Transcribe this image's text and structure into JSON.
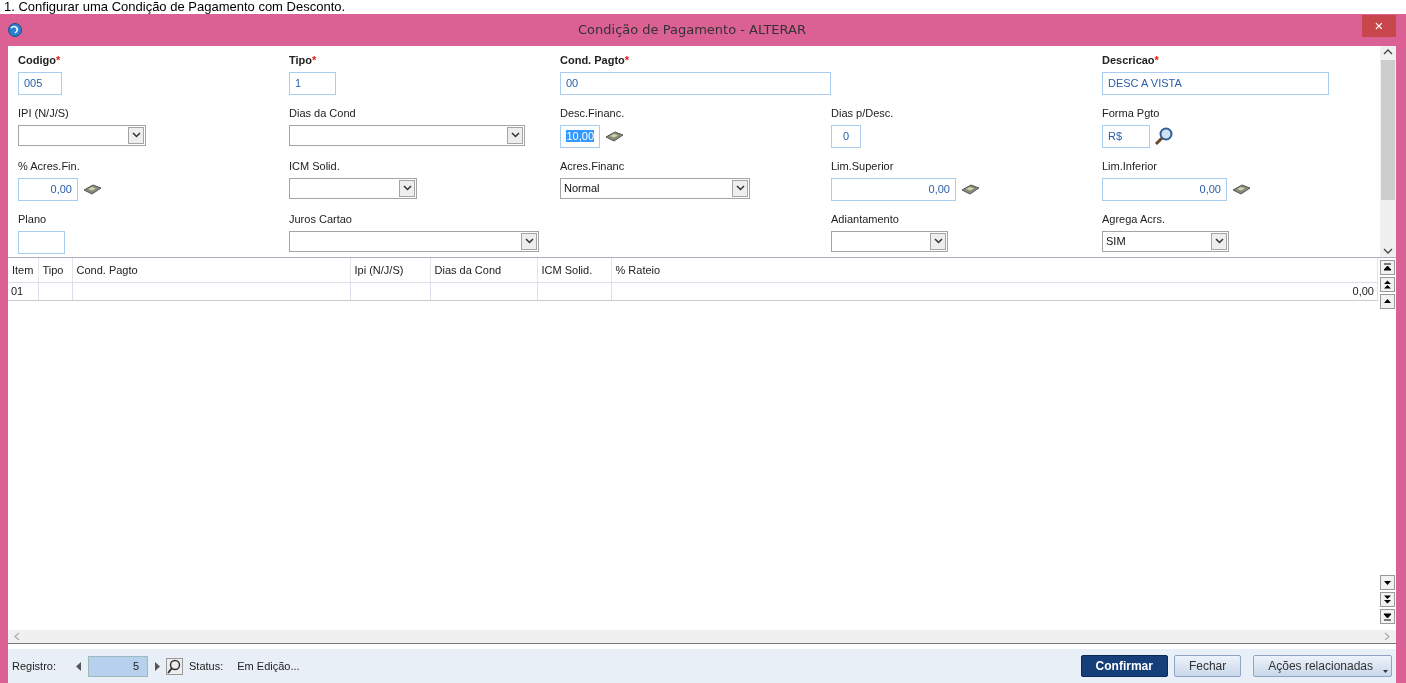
{
  "doc_heading": "1.    Configurar uma Condição de Pagamento com Desconto.",
  "window": {
    "title": "Condição de Pagamento - ALTERAR",
    "close": "×"
  },
  "form_rows": [
    [
      {
        "label": "Codigo",
        "mark": "*",
        "kind": "text",
        "value": "005"
      },
      {
        "label": "Tipo",
        "mark": "*",
        "kind": "text",
        "value": "1"
      },
      {
        "label": "Cond. Pagto",
        "mark": "*",
        "kind": "text",
        "value": "00"
      },
      null,
      {
        "label": "Descricao",
        "mark": "*",
        "kind": "text",
        "value": "DESC A VISTA"
      }
    ],
    [
      {
        "label": "IPI (N/J/S)",
        "kind": "select"
      },
      {
        "label": "Dias da Cond",
        "kind": "select"
      },
      {
        "label": "Desc.Financ.",
        "kind": "money",
        "value": "10,00",
        "selected": true
      },
      {
        "label": "Dias p/Desc.",
        "kind": "number",
        "value": "0"
      },
      {
        "label": "Forma Pgto",
        "kind": "lookup",
        "value": "R$"
      }
    ],
    [
      {
        "label": "% Acres.Fin.",
        "kind": "money",
        "value": "0,00",
        "selected": false
      },
      {
        "label": "ICM Solid.",
        "kind": "select"
      },
      {
        "label": "Acres.Financ",
        "kind": "select",
        "value": "Normal"
      },
      {
        "label": "Lim.Superior",
        "kind": "money",
        "value": "0,00",
        "selected": false
      },
      {
        "label": "Lim.Inferior",
        "kind": "money",
        "value": "0,00",
        "selected": false
      }
    ],
    [
      {
        "label": "Plano",
        "kind": "text"
      },
      {
        "label": "Juros Cartao",
        "kind": "select"
      },
      null,
      {
        "label": "Adiantamento",
        "kind": "select"
      },
      {
        "label": "Agrega Acrs.",
        "kind": "select",
        "value": "SIM"
      }
    ]
  ],
  "table": {
    "columns": [
      "Item",
      "Tipo",
      "Cond. Pagto",
      "Ipi (N/J/S)",
      "Dias da Cond",
      "ICM Solid.",
      "% Rateio"
    ],
    "rows": [
      [
        "01",
        null,
        null,
        null,
        null,
        null,
        "0,00"
      ]
    ]
  },
  "footer": {
    "record_label": "Registro:",
    "record_value": "5",
    "status_label": "Status:",
    "status_value": "Em Edição...",
    "buttons": [
      {
        "label": "Confirmar",
        "kind": "primary"
      },
      {
        "label": "Fechar",
        "kind": "plain"
      },
      {
        "label": "Ações relacionadas",
        "kind": "menu"
      }
    ]
  }
}
